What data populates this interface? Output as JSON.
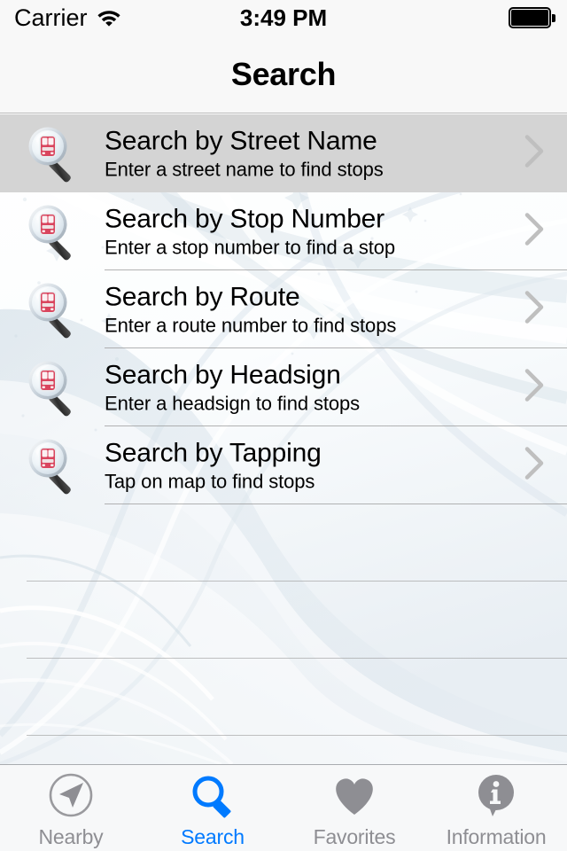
{
  "status_bar": {
    "carrier": "Carrier",
    "wifi_icon": "wifi-icon",
    "time": "3:49 PM",
    "battery_icon": "battery-full-icon"
  },
  "nav": {
    "title": "Search"
  },
  "colors": {
    "accent": "#007aff",
    "inactive_tab": "#8e8e93",
    "selected_row_bg": "#d4d4d4",
    "separator": "#9a9a9a",
    "bar_bg": "#f8f8f8",
    "bus_icon_red": "#d6435b"
  },
  "list": {
    "rows": [
      {
        "icon": "magnifier-bus-icon",
        "title": "Search by Street Name",
        "subtitle": "Enter a street name to find stops",
        "accessory": "chevron-right-icon",
        "selected": true
      },
      {
        "icon": "magnifier-bus-icon",
        "title": "Search by Stop Number",
        "subtitle": "Enter a stop number to find a stop",
        "accessory": "chevron-right-icon",
        "selected": false
      },
      {
        "icon": "magnifier-bus-icon",
        "title": "Search by Route",
        "subtitle": "Enter a route number to find stops",
        "accessory": "chevron-right-icon",
        "selected": false
      },
      {
        "icon": "magnifier-bus-icon",
        "title": "Search by Headsign",
        "subtitle": "Enter a headsign to find stops",
        "accessory": "chevron-right-icon",
        "selected": false
      },
      {
        "icon": "magnifier-bus-icon",
        "title": "Search by Tapping",
        "subtitle": "Tap on map to find stops",
        "accessory": "chevron-right-icon",
        "selected": false
      }
    ],
    "empty_row_count": 4
  },
  "tabbar": {
    "tabs": [
      {
        "label": "Nearby",
        "icon": "navigation-arrow-circle-icon",
        "active": false
      },
      {
        "label": "Search",
        "icon": "magnifier-icon",
        "active": true
      },
      {
        "label": "Favorites",
        "icon": "heart-icon",
        "active": false
      },
      {
        "label": "Information",
        "icon": "info-speech-bubble-icon",
        "active": false
      }
    ]
  }
}
